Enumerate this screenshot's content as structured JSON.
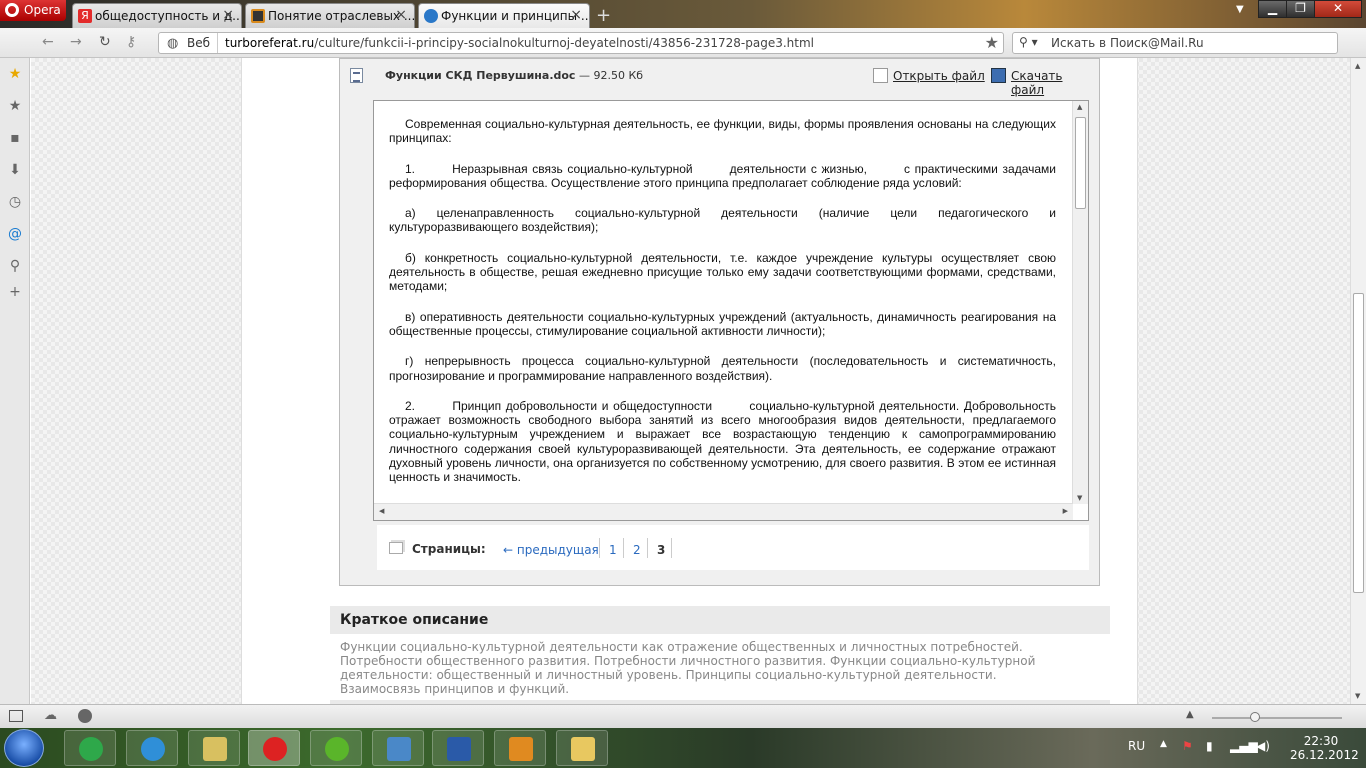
{
  "browser": {
    "menu_label": "Opera",
    "tabs": [
      {
        "label": "общедоступность и д...",
        "color": "#e32b2b",
        "glyph": "Я"
      },
      {
        "label": "Понятие отраслевых ...",
        "color": "#d98b1e",
        "glyph": "✕"
      },
      {
        "label": "Функции и принципы ...",
        "color": "#2a78c8",
        "glyph": "◐"
      }
    ],
    "new_tab_icon": "plus-icon",
    "address": {
      "mode_label": "Веб",
      "domain": "turboreferat.ru",
      "path": "/culture/funkcii-i-principy-socialnokulturnoj-deyatelnosti/43856-231728-page3.html"
    },
    "search_placeholder": "Искать в Поиск@Mail.Ru"
  },
  "document": {
    "file_name": "Функции СКД Первушина.doc",
    "separator": "—",
    "file_size": "92.50 Кб",
    "open_label": "Открыть файл",
    "download_label": "Скачать файл",
    "paragraphs": [
      "Современная социально-культурная деятельность, ее функции, виды, формы проявления основаны на следующих принципах:",
      "1.        Неразрывная связь социально-культурной        деятельности с жизнью,        с практическими задачами реформирования общества. Осуществление этого принципа предполагает соблюдение ряда условий:",
      "а) целенаправленность социально-культурной деятельности (наличие цели педагогического и культуроразвивающего воздействия);",
      "б) конкретность социально-культурной деятельности, т.е. каждое учреждение культуры осуществляет свою деятельность в обществе, решая ежедневно присущие только ему задачи соответствующими формами, средствами, методами;",
      "в) оперативность деятельности социально-культурных учреждений (актуальность, динамичность реагирования на общественные процессы, стимулирование социальной активности личности);",
      "г) непрерывность процесса социально-культурной деятельности (последовательность и систематичность, прогнозирование и программирование направленного воздействия).",
      "2.        Принцип добровольности и общедоступности        социально-культурной деятельности. Добровольность отражает возможность свободного выбора занятий из всего многообразия видов деятельности, предлагаемого социально-культурным учреждением и выражает все возрастающую тенденцию к самопрограммированию личностного содержания своей культуроразвивающей деятельности. Эта деятельность, ее содержание отражают духовный уровень личности, она организуется по собственному усмотрению, для своего развития. В этом ее истинная ценность и значимость."
    ]
  },
  "pagination": {
    "label": "Страницы:",
    "prev_label": "← предыдущая",
    "pages": [
      "1",
      "2",
      "3"
    ],
    "current": "3"
  },
  "summary": {
    "heading": "Краткое описание",
    "text": "Функции социально-культурной деятельности как отражение общественных и личностных потребностей. Потребности общественного развития. Потребности личностного развития. Функции социально-культурной деятельности: общественный и личностный уровень. Принципы социально-культурной деятельности. Взаимосвязь принципов и функций."
  },
  "taskbar": {
    "lang": "RU",
    "time": "22:30",
    "date": "26.12.2012"
  }
}
